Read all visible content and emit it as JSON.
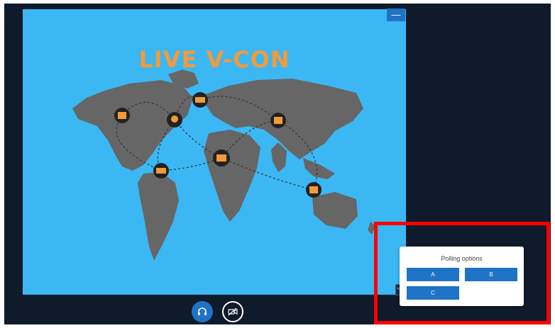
{
  "slide": {
    "title": "LIVE V-CON",
    "minimize_label": "—"
  },
  "controls": {
    "audio_icon": "headset-icon",
    "video_icon": "camera-off-icon"
  },
  "poll": {
    "title": "Polling options",
    "options": [
      {
        "label": "A"
      },
      {
        "label": "B"
      },
      {
        "label": "C"
      }
    ]
  },
  "colors": {
    "stage_bg": "#0f1a2b",
    "slide_bg": "#3bb7f4",
    "title": "#f29a3c",
    "accent_blue": "#1f73c6",
    "map_land": "#666666",
    "highlight": "#ff0000"
  }
}
